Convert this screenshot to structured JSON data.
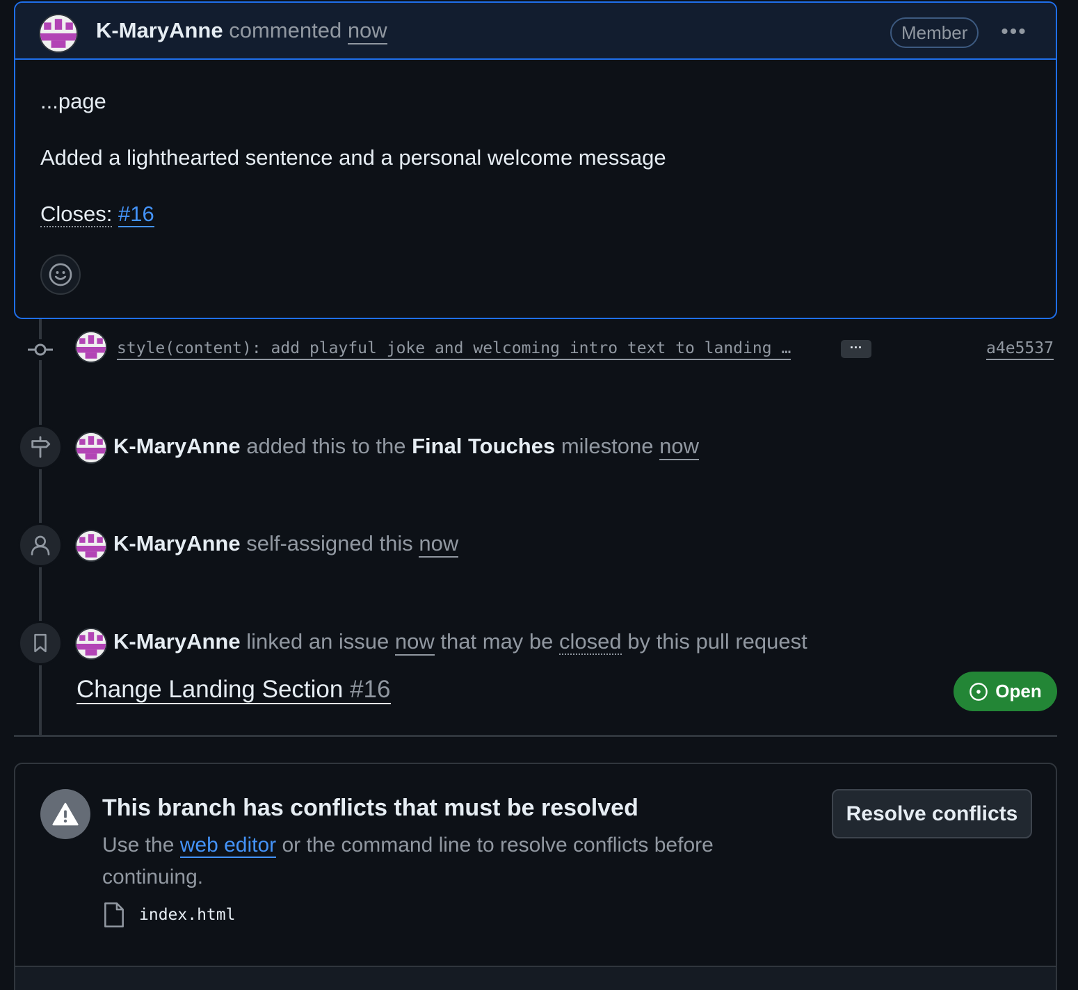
{
  "comment": {
    "author": "K-MaryAnne",
    "action": "commented",
    "time": "now",
    "badge": "Member",
    "menu_icon": "kebab-horizontal-icon",
    "body_line1": "...page",
    "body_line2": "Added a lighthearted sentence and a personal welcome message",
    "closes_label": "Closes:",
    "closes_issue": "#16",
    "reaction_icon": "smiley-icon"
  },
  "commit": {
    "message": "style(content): add playful joke and welcoming intro text to landing …",
    "more_label": "···",
    "sha": "a4e5537"
  },
  "events": {
    "milestone": {
      "author": "K-MaryAnne",
      "pre": "added this to the",
      "milestone": "Final Touches",
      "post": "milestone",
      "time": "now"
    },
    "assigned": {
      "author": "K-MaryAnne",
      "text": "self-assigned this",
      "time": "now"
    },
    "linked": {
      "author": "K-MaryAnne",
      "pre": "linked an issue",
      "time": "now",
      "mid": "that may be",
      "closed_word": "closed",
      "post": "by this pull request",
      "issue_title": "Change Landing Section",
      "issue_number": "#16",
      "status": "Open"
    }
  },
  "merge": {
    "title": "This branch has conflicts that must be resolved",
    "desc_pre": "Use the",
    "desc_link": "web editor",
    "desc_post": "or the command line to resolve conflicts before continuing.",
    "file": "index.html",
    "resolve_button": "Resolve conflicts"
  },
  "colors": {
    "accent_blue": "#1f6feb",
    "open_green": "#238636",
    "link_blue": "#4493f8",
    "avatar_purple": "#b244b5"
  }
}
